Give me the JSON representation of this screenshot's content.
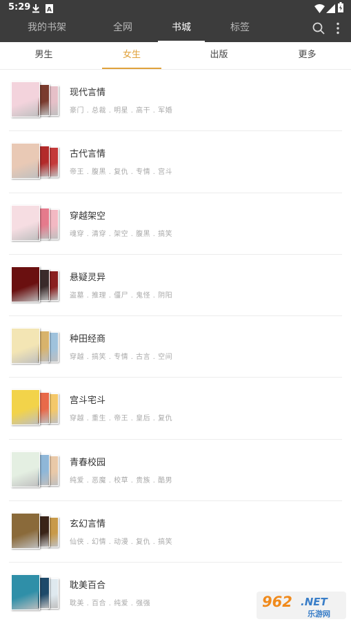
{
  "status_bar": {
    "time": "5:29",
    "icons": [
      "download-icon",
      "notification-a-icon",
      "wifi-icon",
      "signal-icon",
      "battery-icon"
    ]
  },
  "top_nav": {
    "tabs": [
      "我的书架",
      "全网",
      "书城",
      "标签"
    ],
    "active_tab": "书城",
    "icons": [
      "search-icon",
      "more-vert-icon"
    ]
  },
  "sub_tabs": {
    "tabs": [
      "男生",
      "女生",
      "出版",
      "更多"
    ],
    "active_tab": "女生",
    "accent_color": "#e0a13a"
  },
  "categories": [
    {
      "title": "现代言情",
      "tags": "豪门 . 总裁 . 明星 . 高干 . 军婚",
      "colors": [
        "#f3d3dc",
        "#7a3b2e",
        "#e6c0c8"
      ]
    },
    {
      "title": "古代言情",
      "tags": "帝王 . 腹黑 . 复仇 . 专情 . 宫斗",
      "colors": [
        "#e9c9b5",
        "#b32a2a",
        "#c43a3a"
      ]
    },
    {
      "title": "穿越架空",
      "tags": "魂穿 . 清穿 . 架空 . 腹黑 . 搞笑",
      "colors": [
        "#f6dde2",
        "#e57a8c",
        "#f3b9c3"
      ]
    },
    {
      "title": "悬疑灵异",
      "tags": "盗墓 . 推理 . 僵尸 . 鬼怪 . 阴阳",
      "colors": [
        "#6a1010",
        "#3a2a2a",
        "#8a2020"
      ]
    },
    {
      "title": "种田经商",
      "tags": "穿越 . 搞笑 . 专情 . 古言 . 空间",
      "colors": [
        "#f3e5b4",
        "#d8b36c",
        "#9fc2dc"
      ]
    },
    {
      "title": "宫斗宅斗",
      "tags": "穿越 . 重生 . 帝王 . 皇后 . 复仇",
      "colors": [
        "#f2d34a",
        "#e86a4a",
        "#f4c86a"
      ]
    },
    {
      "title": "青春校园",
      "tags": "纯爱 . 恶魔 . 校草 . 贵族 . 酷男",
      "colors": [
        "#e4efe2",
        "#8fb7d8",
        "#e9c9a8"
      ]
    },
    {
      "title": "玄幻言情",
      "tags": "仙侠 . 幻情 . 动漫 . 复仇 . 搞笑",
      "colors": [
        "#8a6a3a",
        "#3a2418",
        "#c89a4a"
      ]
    },
    {
      "title": "耽美百合",
      "tags": "耽美 . 百合 . 纯爱 . 强强",
      "colors": [
        "#2f8fa8",
        "#1e4a6a",
        "#dfe9ef"
      ]
    }
  ],
  "watermark": {
    "text_top": "962.NET",
    "text_bottom": "乐游网"
  }
}
